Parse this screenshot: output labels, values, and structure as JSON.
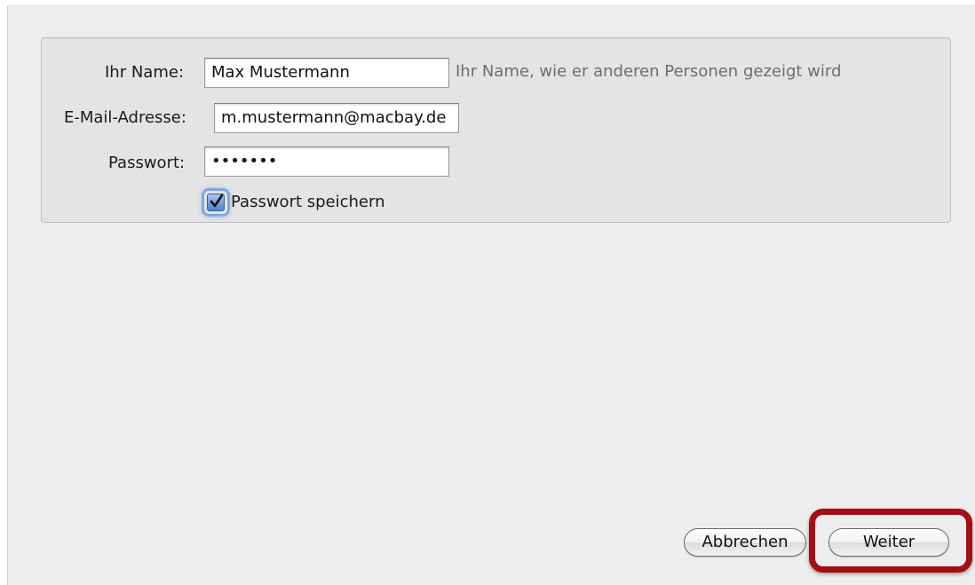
{
  "form": {
    "name_label": "Ihr Name:",
    "name_value": "Max Mustermann",
    "name_hint": "Ihr Name, wie er anderen Personen gezeigt wird",
    "email_label": "E-Mail-Adresse:",
    "email_value": "m.mustermann@macbay.de",
    "password_label": "Passwort:",
    "password_value": "•••••••",
    "save_password_label": "Passwort speichern",
    "save_password_checked": true
  },
  "footer": {
    "cancel_label": "Abbrechen",
    "continue_label": "Weiter"
  },
  "colors": {
    "window_bg": "#ededed",
    "panel_bg": "#e4e4e4",
    "checkbox_accent": "#4f82cd",
    "highlight_border": "#a30f14"
  }
}
